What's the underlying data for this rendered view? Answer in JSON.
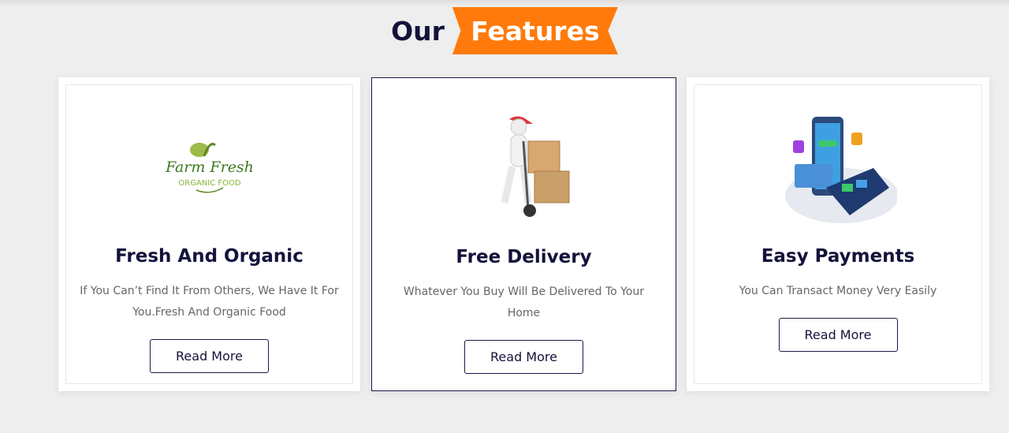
{
  "heading": {
    "prefix": "Our",
    "highlight": "Features"
  },
  "colors": {
    "accent": "#ff7a0a",
    "navy": "#14133b"
  },
  "cards": [
    {
      "title": "Fresh And Organic",
      "description": "If You Can’t Find It From Others, We Have It For You.Fresh And Organic Food",
      "button": "Read More",
      "image": "farm-fresh-logo",
      "logo_text": "Farm Fresh",
      "logo_sub": "ORGANIC FOOD"
    },
    {
      "title": "Free Delivery",
      "description": "Whatever You Buy Will Be Delivered To Your Home",
      "button": "Read More",
      "image": "delivery-man-with-boxes"
    },
    {
      "title": "Easy Payments",
      "description": "You Can Transact Money Very Easily",
      "button": "Read More",
      "image": "payment-terminal-phone"
    }
  ]
}
